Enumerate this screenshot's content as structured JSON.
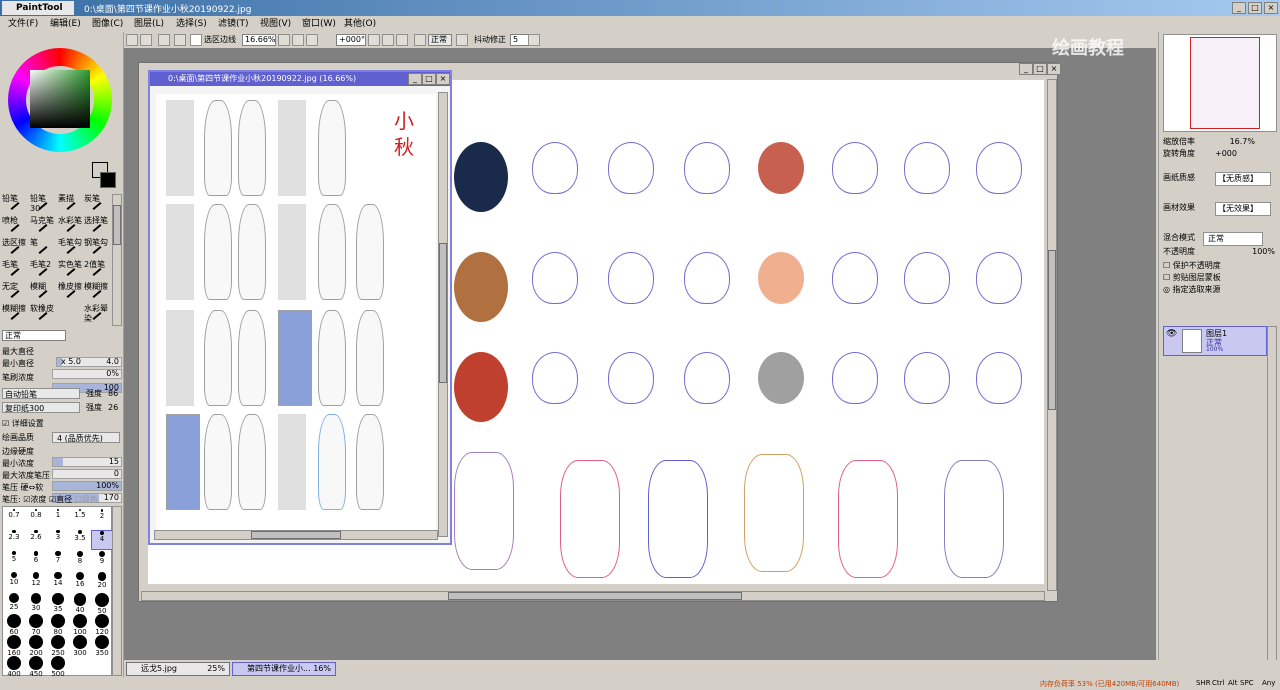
{
  "app": {
    "logo_text": "PaintTool SAI",
    "title_path": "0:\\桌面\\第四节课作业小秋20190922.jpg"
  },
  "menu": [
    "文件(F)",
    "编辑(E)",
    "图像(C)",
    "图层(L)",
    "选择(S)",
    "滤镜(T)",
    "视图(V)",
    "窗口(W)",
    "其他(O)"
  ],
  "toolbar": {
    "selection_edge_label": "选区边线",
    "zoom": "16.66%",
    "rotation": "+000°",
    "blend_mode": "正常",
    "stabilizer_label": "抖动修正",
    "stabilizer_value": "5"
  },
  "left_panel": {
    "brush_tools": [
      "铅笔",
      "铅笔30",
      "素描",
      "炭笔",
      "喷枪",
      "马克笔",
      "水彩笔",
      "选择笔",
      "选区擦",
      "笔",
      "毛笔勾",
      "钢笔勾",
      "毛笔",
      "毛笔2",
      "实色笔",
      "2值笔",
      "无定",
      "模糊",
      "橡皮擦",
      "模糊擦",
      "模糊擦",
      "软橡皮",
      "水彩晕染"
    ],
    "blend_mode": "正常",
    "params": [
      {
        "label": "最大直径",
        "mult": "x 5.0",
        "value": "4.0"
      },
      {
        "label": "最小直径",
        "value": "0%"
      },
      {
        "label": "笔刷浓度",
        "value": "100"
      }
    ],
    "shape_label": "自动铅笔",
    "shape_strength_label": "强度",
    "shape_strength": "86",
    "texture_label": "复印纸300",
    "texture_strength_label": "强度",
    "texture_strength": "26",
    "detail_label": "详细设置",
    "quality_label": "绘画品质",
    "quality_value": "4 (品质优先)",
    "edge_hardness_label": "边缘硬度",
    "edge_hardness": "15",
    "min_density_label": "最小浓度",
    "min_density": "0",
    "max_density_pressure_label": "最大浓度笔压",
    "max_density_pressure": "100%",
    "pressure_label": "笔压 硬⇔软",
    "pressure_value": "170",
    "pressure_opts": [
      "笔压:",
      "浓度",
      "直径",
      "混色"
    ],
    "brush_sizes": [
      "0.7",
      "0.8",
      "1",
      "1.5",
      "2",
      "2.3",
      "2.6",
      "3",
      "3.5",
      "4",
      "5",
      "6",
      "7",
      "8",
      "9",
      "10",
      "12",
      "14",
      "16",
      "20",
      "25",
      "30",
      "35",
      "40",
      "50",
      "60",
      "70",
      "80",
      "100",
      "120",
      "160",
      "200",
      "250",
      "300",
      "350",
      "400",
      "450",
      "500"
    ]
  },
  "ref_window": {
    "title": "0:\\桌面\\第四节课作业小秋20190922.jpg (16.66%)",
    "signature": "小秋"
  },
  "watermark": "绘画教程",
  "right_panel": {
    "zoom_label": "缩放倍率",
    "zoom_value": "16.7%",
    "angle_label": "旋转角度",
    "angle_value": "+000",
    "paper_texture_label": "画纸质感",
    "paper_texture_value": "【无质感】",
    "material_effect_label": "画材效果",
    "material_effect_value": "【无效果】",
    "blend_label": "混合模式",
    "blend_value": "正常",
    "opacity_label": "不透明度",
    "opacity_value": "100%",
    "checks": [
      "保护不透明度",
      "剪贴图层蒙板",
      "指定选取来源"
    ],
    "layer_name": "图层1",
    "layer_mode": "正常",
    "layer_opacity": "100%"
  },
  "status": {
    "tabs": [
      {
        "name": "远戈5.jpg",
        "zoom": "25%"
      },
      {
        "name": "第四节课作业小...",
        "zoom": "16%"
      }
    ],
    "memory": "内存负荷率 53% (已用420MB/可用640MB)",
    "keys": [
      "SHR",
      "Ctrl",
      "Alt",
      "SPC"
    ],
    "any": "Any"
  },
  "colors": {
    "accent": "#6060d0",
    "title_gradient_start": "#3a6ea5",
    "primary_color": "#000000",
    "secondary_color": "#ffffff",
    "status_text": "#c04000"
  }
}
